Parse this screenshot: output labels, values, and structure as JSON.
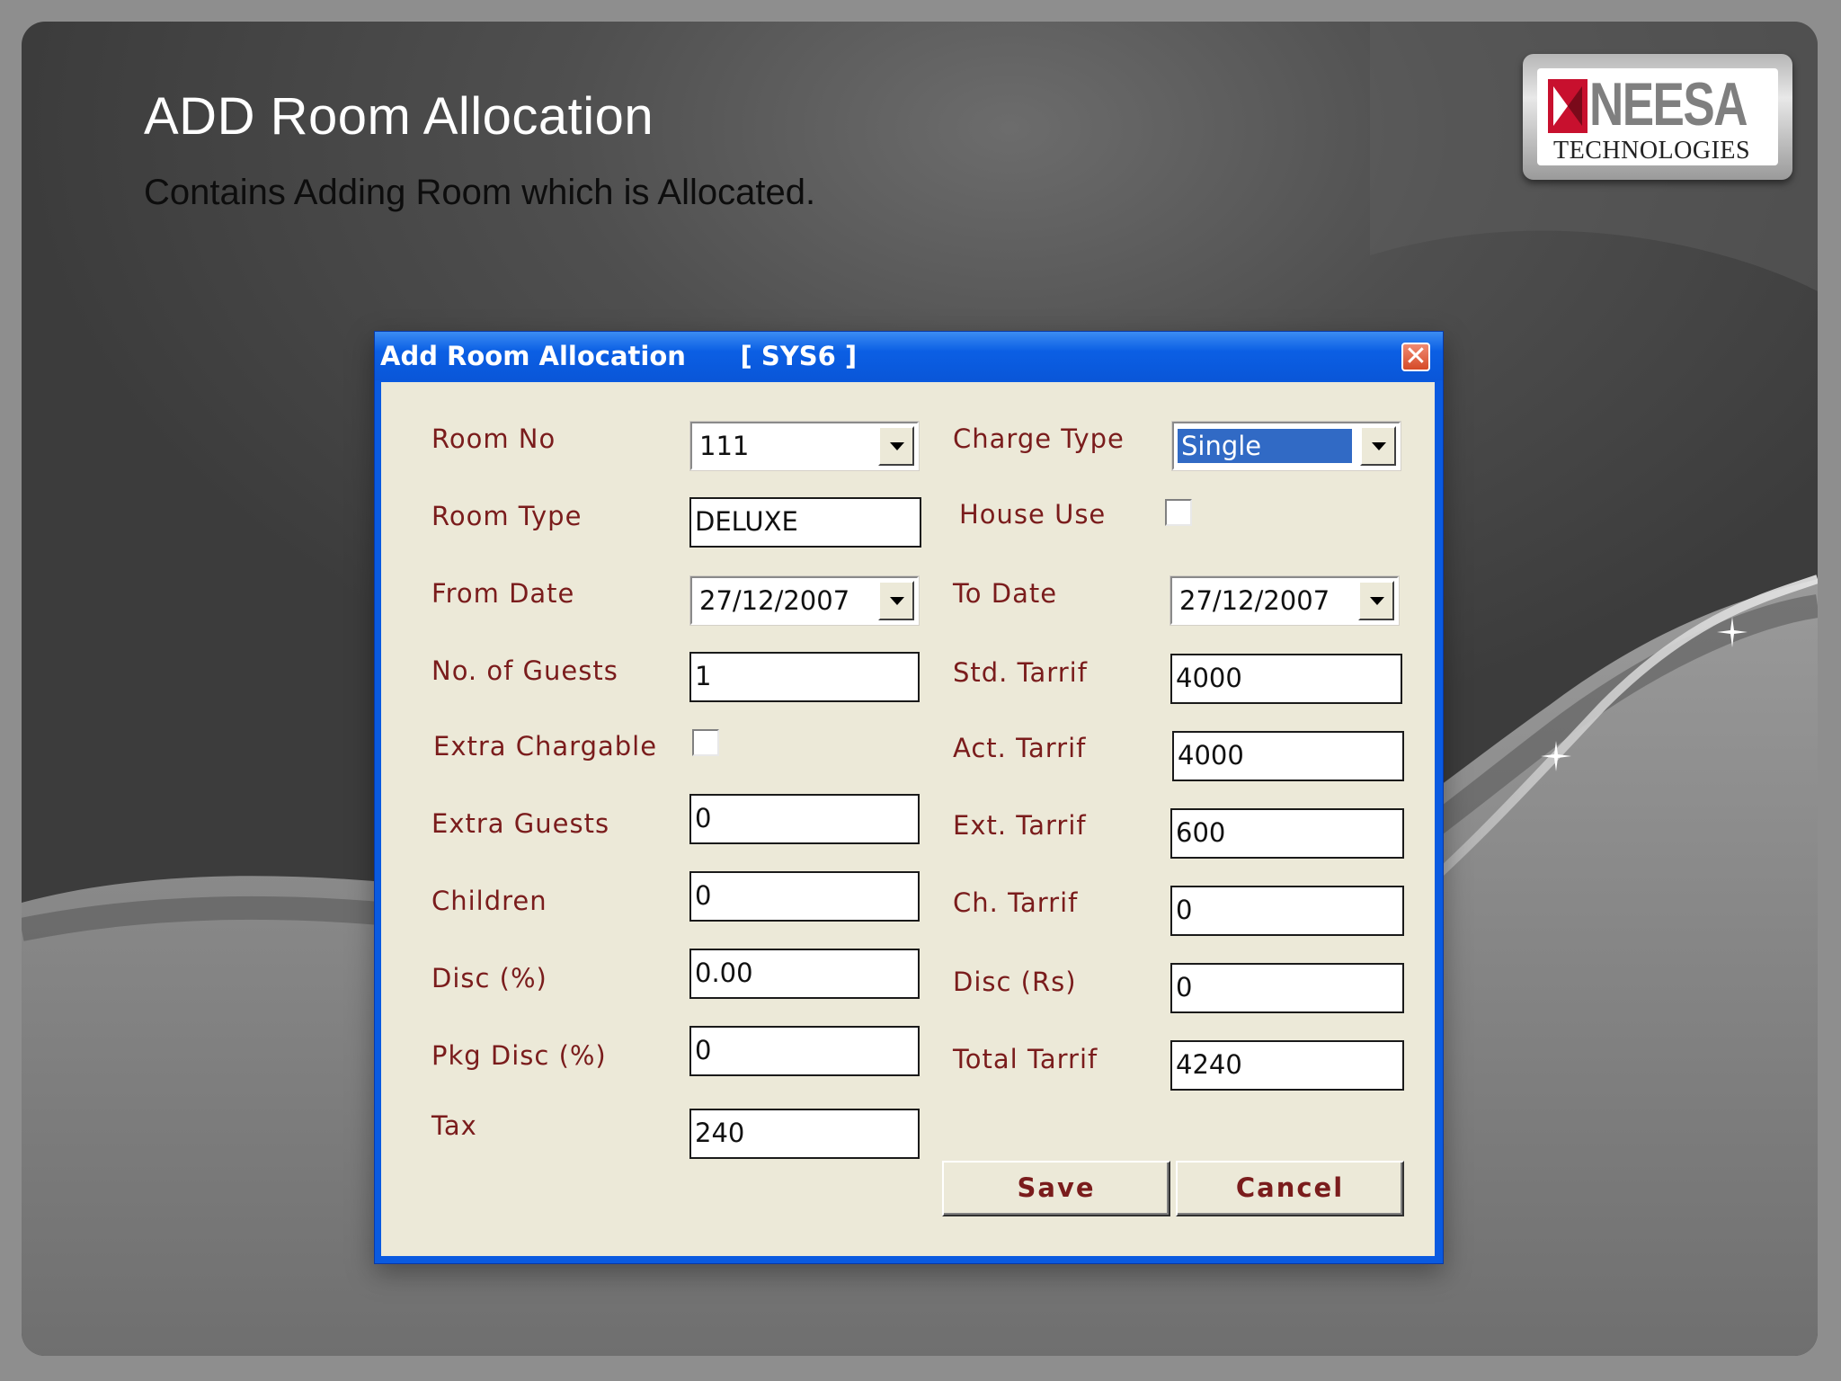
{
  "slide": {
    "title": "ADD Room Allocation",
    "subtitle": "Contains Adding Room which is Allocated.",
    "logo_name": "NEESA",
    "logo_sub": "TECHNOLOGIES"
  },
  "dialog": {
    "title": "Add Room Allocation      [ SYS6 ]",
    "close_glyph": "✕",
    "fields": {
      "room_no": {
        "label": "Room No",
        "value": "111"
      },
      "room_type": {
        "label": "Room Type",
        "value": "DELUXE"
      },
      "from_date": {
        "label": "From Date",
        "value": "27/12/2007"
      },
      "guests": {
        "label": "No. of Guests",
        "value": "1"
      },
      "extra_chargable": {
        "label": "Extra Chargable"
      },
      "extra_guests": {
        "label": "Extra Guests",
        "value": "0"
      },
      "children": {
        "label": "Children",
        "value": "0"
      },
      "disc_pct": {
        "label": "Disc (%)",
        "value": "0.00"
      },
      "pkg_disc": {
        "label": "Pkg Disc (%)",
        "value": "0"
      },
      "tax": {
        "label": "Tax",
        "value": "240"
      },
      "charge_type": {
        "label": "Charge Type",
        "value": "Single"
      },
      "house_use": {
        "label": "House Use"
      },
      "to_date": {
        "label": "To Date",
        "value": "27/12/2007"
      },
      "std_tarrif": {
        "label": "Std. Tarrif",
        "value": "4000"
      },
      "act_tarrif": {
        "label": "Act. Tarrif",
        "value": "4000"
      },
      "ext_tarrif": {
        "label": "Ext. Tarrif",
        "value": "600"
      },
      "ch_tarrif": {
        "label": "Ch. Tarrif",
        "value": "0"
      },
      "disc_rs": {
        "label": "Disc (Rs)",
        "value": "0"
      },
      "total_tarrif": {
        "label": "Total Tarrif",
        "value": "4240"
      }
    },
    "buttons": {
      "save": "Save",
      "cancel": "Cancel"
    }
  },
  "colors": {
    "titlebar": "#0a5ae0",
    "label": "#7a1c1c",
    "client": "#ece9d8",
    "selection": "#316ac5"
  }
}
